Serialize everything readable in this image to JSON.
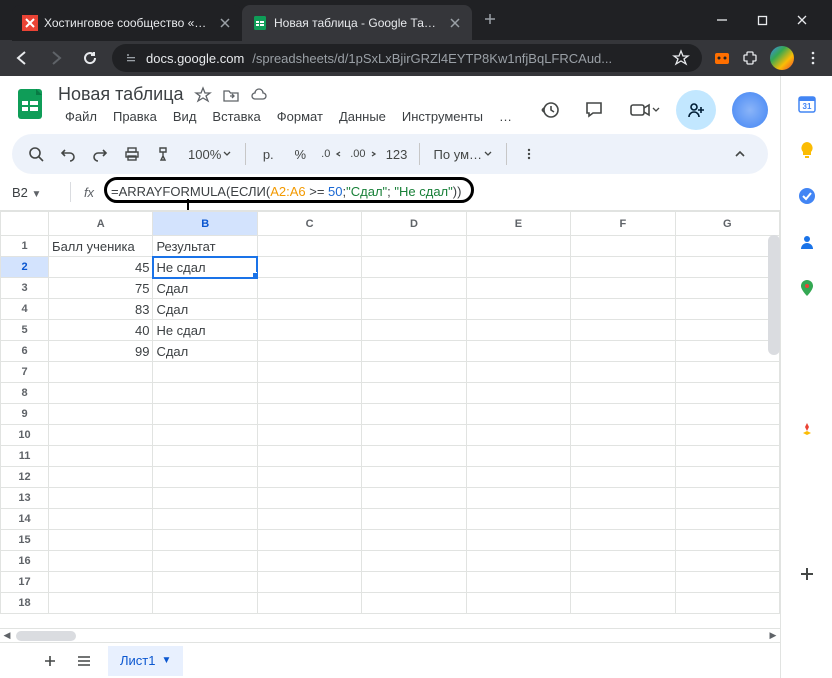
{
  "browser": {
    "tabs": [
      {
        "label": "Хостинговое сообщество «Tim",
        "active": false
      },
      {
        "label": "Новая таблица - Google Табли",
        "active": true
      }
    ],
    "url_host": "docs.google.com",
    "url_path": "/spreadsheets/d/1pSxLxBjirGRZl4EYTP8Kw1nfjBqLFRCAud..."
  },
  "doc": {
    "title": "Новая таблица",
    "menus": [
      "Файл",
      "Правка",
      "Вид",
      "Вставка",
      "Формат",
      "Данные",
      "Инструменты",
      "…"
    ]
  },
  "toolbar": {
    "zoom": "100%",
    "currency": "р.",
    "percent": "%",
    "dec_dec": ".0",
    "inc_dec": ".00",
    "numfmt": "123",
    "font": "По ум…"
  },
  "fx": {
    "cellref": "B2",
    "formula_parts": {
      "p0": "=",
      "p1": "ARRAYFORMULA",
      "p2": "(",
      "p3": "ЕСЛИ",
      "p4": "(",
      "range": "A2:A6",
      "p5": " >= ",
      "num": "50",
      "p6": ";",
      "s1": "\"Сдал\"",
      "p7": "; ",
      "s2": "\"Не сдал\"",
      "p8": "))"
    }
  },
  "grid": {
    "cols": [
      "A",
      "B",
      "C",
      "D",
      "E",
      "F",
      "G"
    ],
    "rows": [
      1,
      2,
      3,
      4,
      5,
      6,
      7,
      8,
      9,
      10,
      11,
      12,
      13,
      14,
      15,
      16,
      17,
      18
    ],
    "headers": {
      "A1": "Балл ученика",
      "B1": "Результат"
    },
    "data": [
      {
        "A": "45",
        "B": "Не сдал"
      },
      {
        "A": "75",
        "B": "Сдал"
      },
      {
        "A": "83",
        "B": "Сдал"
      },
      {
        "A": "40",
        "B": "Не сдал"
      },
      {
        "A": "99",
        "B": "Сдал"
      }
    ],
    "active": "B2"
  },
  "sheet": {
    "name": "Лист1"
  },
  "chart_data": null
}
